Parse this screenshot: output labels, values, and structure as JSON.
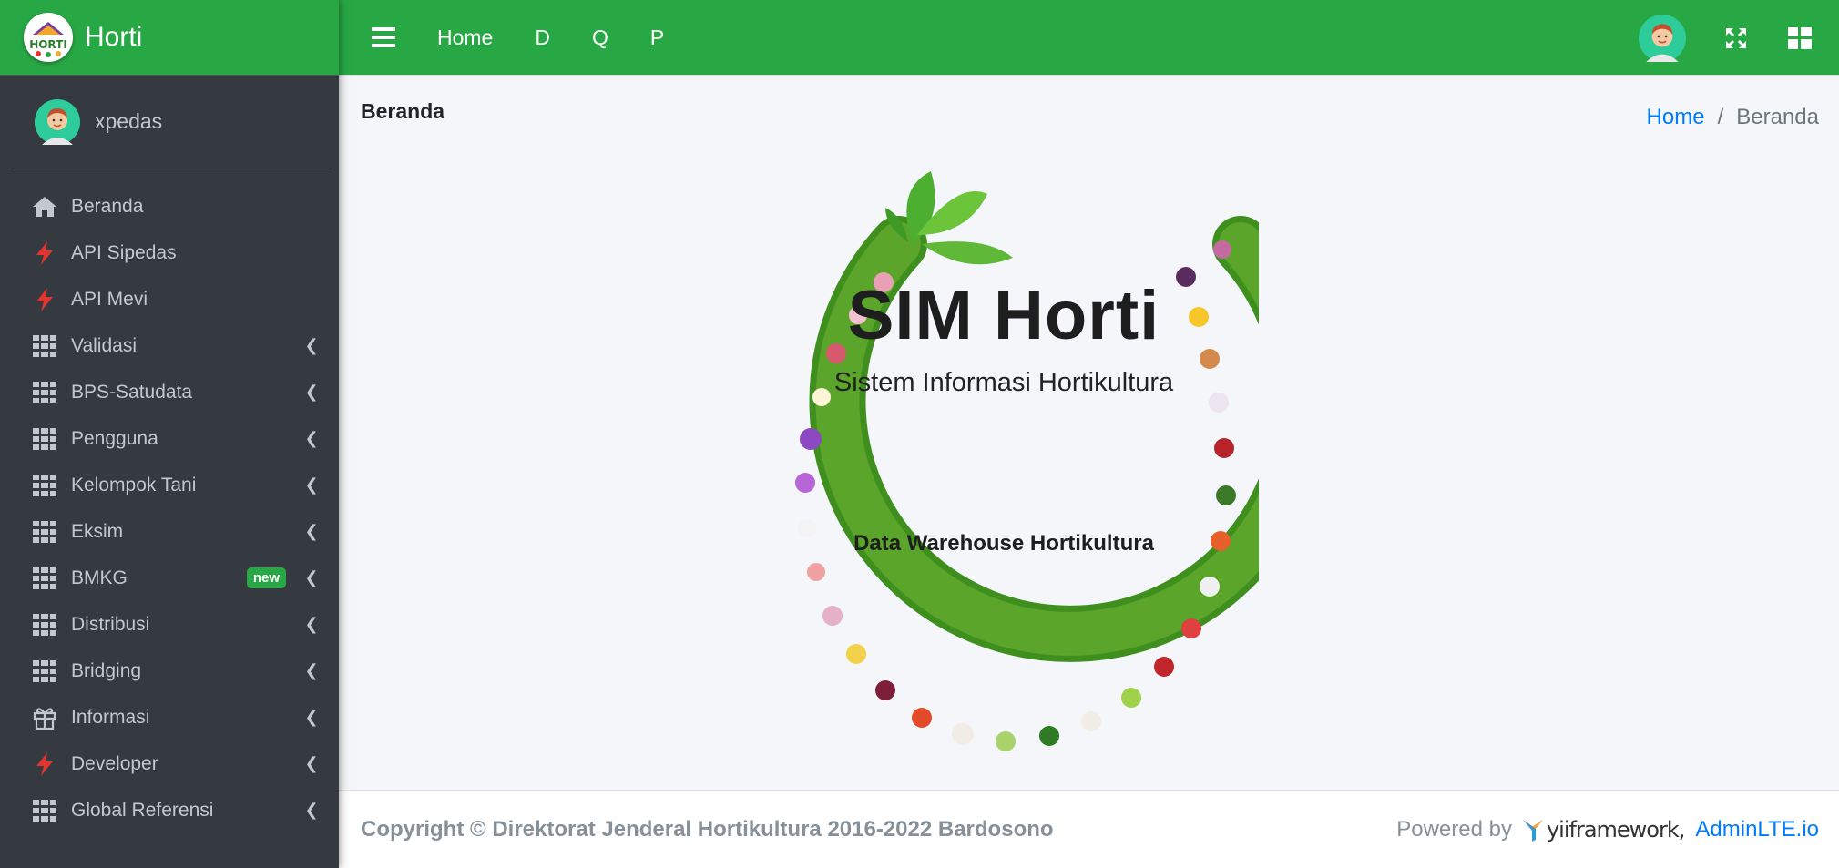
{
  "brand": {
    "name": "Horti",
    "logo_text": "HORTI"
  },
  "user": {
    "name": "xpedas"
  },
  "sidebar": {
    "items": [
      {
        "label": "Beranda",
        "icon": "home-icon",
        "has_children": false
      },
      {
        "label": "API Sipedas",
        "icon": "bolt-icon",
        "has_children": false
      },
      {
        "label": "API Mevi",
        "icon": "bolt-icon",
        "has_children": false
      },
      {
        "label": "Validasi",
        "icon": "grid-icon",
        "has_children": true
      },
      {
        "label": "BPS-Satudata",
        "icon": "grid-icon",
        "has_children": true
      },
      {
        "label": "Pengguna",
        "icon": "grid-icon",
        "has_children": true
      },
      {
        "label": "Kelompok Tani",
        "icon": "grid-icon",
        "has_children": true
      },
      {
        "label": "Eksim",
        "icon": "grid-icon",
        "has_children": true
      },
      {
        "label": "BMKG",
        "icon": "grid-icon",
        "has_children": true,
        "badge": "new"
      },
      {
        "label": "Distribusi",
        "icon": "grid-icon",
        "has_children": true
      },
      {
        "label": "Bridging",
        "icon": "grid-icon",
        "has_children": true
      },
      {
        "label": "Informasi",
        "icon": "gift-icon",
        "has_children": true
      },
      {
        "label": "Developer",
        "icon": "bolt-icon",
        "has_children": true
      },
      {
        "label": "Global Referensi",
        "icon": "grid-icon",
        "has_children": true
      }
    ]
  },
  "topbar": {
    "links": [
      "Home",
      "D",
      "Q",
      "P"
    ]
  },
  "page": {
    "title": "Beranda",
    "breadcrumb": {
      "home": "Home",
      "separator": "/",
      "current": "Beranda"
    }
  },
  "hero": {
    "title": "SIM Horti",
    "subtitle": "Sistem Informasi Hortikultura",
    "tagline": "Data Warehouse Hortikultura"
  },
  "footer": {
    "copyright": "Copyright © Direktorat Jenderal Hortikultura 2016-2022 Bardosono",
    "powered_by": "Powered by",
    "yii_text": "yiiframework,",
    "adminlte": "AdminLTE.io"
  },
  "colors": {
    "primary_green": "#28a745",
    "sidebar_bg": "#343a40",
    "link_blue": "#007bff",
    "bolt_red": "#e3342f"
  }
}
